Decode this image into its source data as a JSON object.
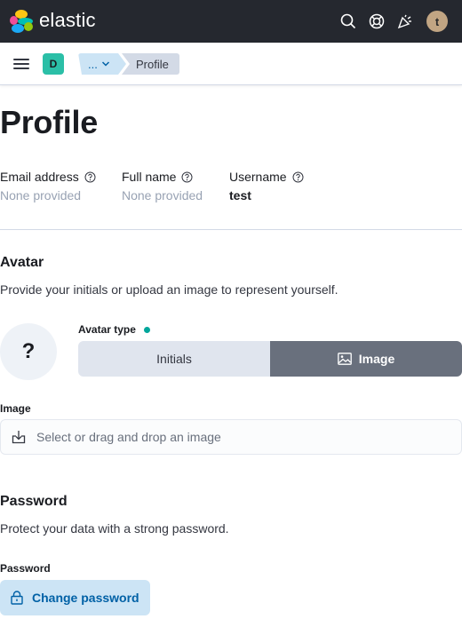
{
  "header": {
    "brand": "elastic",
    "user_initial": "t",
    "icons": [
      "search-icon",
      "help-icon",
      "news-icon"
    ]
  },
  "breadcrumb": {
    "space_initial": "D",
    "collapsed": "...",
    "current": "Profile"
  },
  "page": {
    "title": "Profile"
  },
  "details": {
    "email_label": "Email address",
    "email_value": "None provided",
    "fullname_label": "Full name",
    "fullname_value": "None provided",
    "username_label": "Username",
    "username_value": "test"
  },
  "avatar": {
    "title": "Avatar",
    "description": "Provide your initials or upload an image to represent yourself.",
    "placeholder": "?",
    "type_label": "Avatar type",
    "option_initials": "Initials",
    "option_image": "Image",
    "selected": "Image",
    "image_label": "Image",
    "image_placeholder": "Select or drag and drop an image"
  },
  "password": {
    "title": "Password",
    "description": "Protect your data with a strong password.",
    "label": "Password",
    "button": "Change password"
  },
  "colors": {
    "header_bg": "#25282f",
    "accent": "#0061a6",
    "space_badge": "#2bbfa7",
    "success_dot": "#00a69b"
  }
}
